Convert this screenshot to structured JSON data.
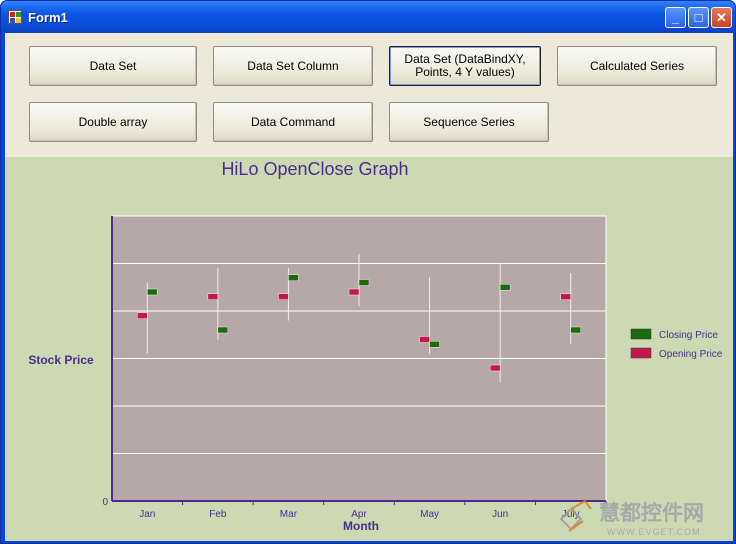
{
  "window": {
    "title": "Form1",
    "minimize_label": "_",
    "maximize_label": "□",
    "close_label": "✕"
  },
  "buttons": [
    {
      "id": "data-set",
      "label": "Data Set"
    },
    {
      "id": "data-set-column",
      "label": "Data Set Column"
    },
    {
      "id": "data-set-databind",
      "label": "Data Set (DataBindXY,\nPoints, 4 Y values)"
    },
    {
      "id": "calculated-series",
      "label": "Calculated Series"
    },
    {
      "id": "double-array",
      "label": "Double array"
    },
    {
      "id": "data-command",
      "label": "Data Command"
    },
    {
      "id": "sequence-series",
      "label": "Sequence Series"
    }
  ],
  "chart_data": {
    "type": "hilo-openclose",
    "title": "HiLo OpenClose Graph",
    "xlabel": "Month",
    "ylabel": "Stock Price",
    "categories": [
      "Jan",
      "Feb",
      "Mar",
      "Apr",
      "May",
      "Jun",
      "July"
    ],
    "y_tick_labels": [
      "0"
    ],
    "ylim": [
      0,
      6
    ],
    "gridlines": [
      1,
      2,
      3,
      4,
      5
    ],
    "series": [
      {
        "name": "Closing Price",
        "color": "#1a6b0a",
        "values": [
          4.4,
          3.6,
          4.7,
          4.6,
          3.3,
          4.5,
          3.6
        ]
      },
      {
        "name": "Opening Price",
        "color": "#c41650",
        "values": [
          3.9,
          4.3,
          4.3,
          4.4,
          3.4,
          2.8,
          4.3
        ]
      }
    ],
    "high": [
      4.6,
      4.9,
      4.9,
      5.2,
      4.7,
      5.0,
      4.8
    ],
    "low": [
      3.1,
      3.4,
      3.8,
      4.1,
      3.1,
      2.5,
      3.3
    ],
    "legend_position": "right",
    "plot_background": "#b7a8a8",
    "panel_background": "#ccdab4"
  },
  "watermark": {
    "brand": "慧都控件网",
    "url": "WWW.EVGET.COM"
  }
}
